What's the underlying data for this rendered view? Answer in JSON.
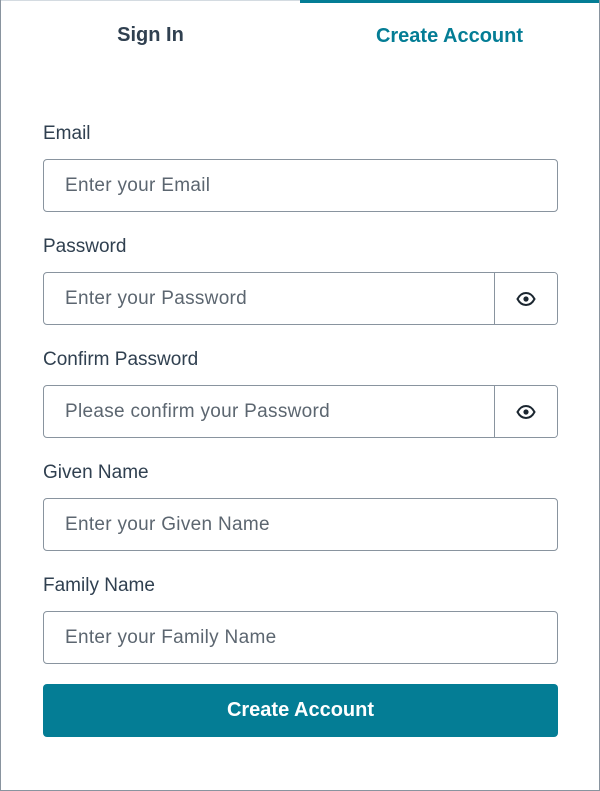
{
  "tabs": {
    "sign_in": "Sign In",
    "create_account": "Create Account",
    "active": "create_account"
  },
  "form": {
    "email": {
      "label": "Email",
      "placeholder": "Enter your Email"
    },
    "password": {
      "label": "Password",
      "placeholder": "Enter your Password",
      "toggle_icon": "eye-icon"
    },
    "confirm_password": {
      "label": "Confirm Password",
      "placeholder": "Please confirm your Password",
      "toggle_icon": "eye-icon"
    },
    "given_name": {
      "label": "Given Name",
      "placeholder": "Enter your Given Name"
    },
    "family_name": {
      "label": "Family Name",
      "placeholder": "Enter your Family Name"
    },
    "submit_label": "Create Account"
  },
  "colors": {
    "accent": "#047d95",
    "text": "#304050",
    "border": "#89949f"
  }
}
